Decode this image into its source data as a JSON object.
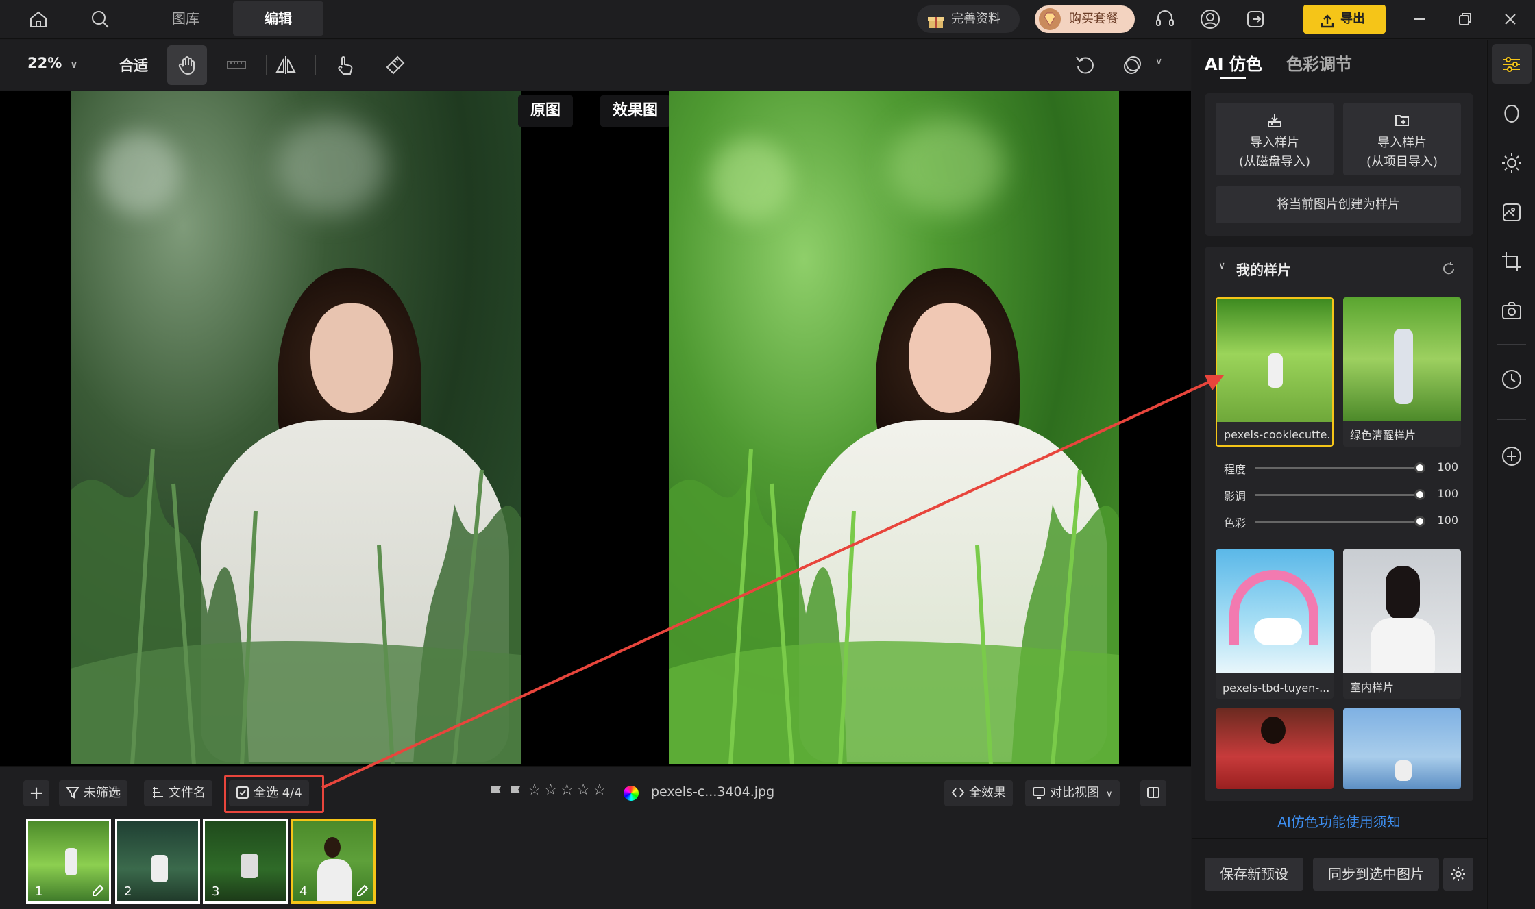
{
  "top": {
    "tabs": [
      {
        "label": "图库"
      },
      {
        "label": "编辑"
      }
    ],
    "complete_info": "完善资料",
    "buy_package": "购买套餐",
    "export": "导出"
  },
  "toolbar": {
    "zoom": "22%",
    "fit": "合适"
  },
  "compare": {
    "original": "原图",
    "effect": "效果图"
  },
  "bottom": {
    "filter": "未筛选",
    "sort": "文件名",
    "select_all": "全选 4/4",
    "filename": "pexels-c...3404.jpg",
    "all_effects": "全效果",
    "compare_view": "对比视图",
    "thumbnails": [
      {
        "num": "1"
      },
      {
        "num": "2"
      },
      {
        "num": "3"
      },
      {
        "num": "4"
      }
    ]
  },
  "right": {
    "tab_ai": "AI 仿色",
    "tab_color": "色彩调节",
    "import_disk_1": "导入样片",
    "import_disk_2": "(从磁盘导入)",
    "import_proj_1": "导入样片",
    "import_proj_2": "(从项目导入)",
    "create_sample": "将当前图片创建为样片",
    "my_samples": "我的样片",
    "samples": [
      {
        "caption": "pexels-cookiecutte..."
      },
      {
        "caption": "绿色清醒样片"
      },
      {
        "caption": "pexels-tbd-tuyen-..."
      },
      {
        "caption": "室内样片"
      }
    ],
    "sliders": [
      {
        "label": "程度",
        "value": 100
      },
      {
        "label": "影调",
        "value": 100
      },
      {
        "label": "色彩",
        "value": 100
      }
    ],
    "help_link": "AI仿色功能使用须知",
    "save_preset": "保存新预设",
    "sync_selected": "同步到选中图片"
  },
  "colors": {
    "accent": "#f5c518",
    "annotation": "#e8453c",
    "link": "#3d8ef0"
  }
}
